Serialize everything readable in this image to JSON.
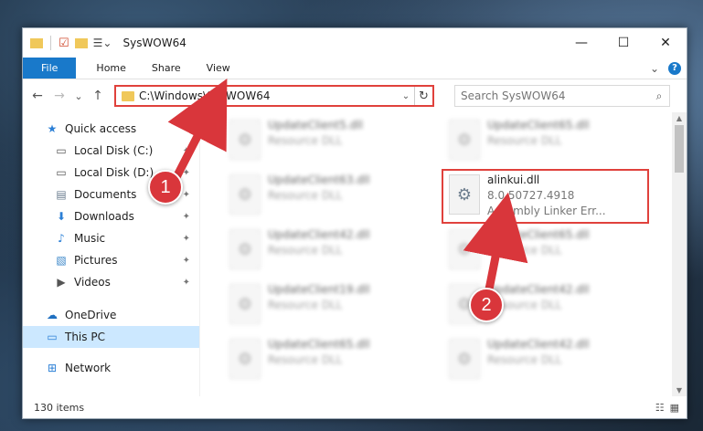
{
  "window": {
    "title": "SysWOW64",
    "controls": {
      "minimize": "—",
      "maximize": "☐",
      "close": "✕"
    }
  },
  "ribbon": {
    "tabs": [
      "File",
      "Home",
      "Share",
      "View"
    ],
    "expand": "⌄",
    "help": "?"
  },
  "navbar": {
    "back": "←",
    "forward": "→",
    "recent": "⌄",
    "up": "↑",
    "address": "C:\\Windows\\SysWOW64",
    "address_chevron": "⌄",
    "refresh": "↻",
    "search_placeholder": "Search SysWOW64"
  },
  "sidebar": {
    "items": [
      {
        "label": "Quick access",
        "icon": "★",
        "color": "#2b7fd6"
      },
      {
        "label": "Local Disk (C:)",
        "icon": "▭",
        "pinned": true
      },
      {
        "label": "Local Disk (D:)",
        "icon": "▭",
        "pinned": true
      },
      {
        "label": "Documents",
        "icon": "▤",
        "pinned": true
      },
      {
        "label": "Downloads",
        "icon": "⬇",
        "pinned": true
      },
      {
        "label": "Music",
        "icon": "♪",
        "pinned": true
      },
      {
        "label": "Pictures",
        "icon": "▧",
        "pinned": true
      },
      {
        "label": "Videos",
        "icon": "▶",
        "pinned": true
      },
      {
        "label": "OneDrive",
        "icon": "☁"
      },
      {
        "label": "This PC",
        "icon": "▭"
      },
      {
        "label": "Network",
        "icon": "⊞"
      }
    ],
    "pin_glyph": "✦"
  },
  "files": {
    "left_column": [
      {
        "name": "UpdateClient5.dll",
        "type": "Resource DLL"
      },
      {
        "name": "UpdateClient63.dll",
        "type": "Resource DLL"
      },
      {
        "name": "UpdateClient42.dll",
        "type": "Resource DLL"
      },
      {
        "name": "UpdateClient19.dll",
        "type": "Resource DLL"
      },
      {
        "name": "UpdateClient65.dll",
        "type": "Resource DLL"
      }
    ],
    "right_column": [
      {
        "name": "UpdateClient65.dll",
        "type": "Resource DLL"
      },
      {
        "name": "alinkui.dll",
        "version": "8.0.50727.4918",
        "type": "Assembly Linker Err..."
      },
      {
        "name": "UpdateClient65.dll",
        "type": "Resource DLL"
      },
      {
        "name": "UpdateClient42.dll",
        "type": "Resource DLL"
      },
      {
        "name": "UpdateClient42.dll",
        "type": "Resource DLL"
      }
    ]
  },
  "status": {
    "count": "130 items",
    "view_details": "☷",
    "view_tiles": "▦"
  },
  "annotations": {
    "badge1": "1",
    "badge2": "2",
    "color": "#d9363b"
  },
  "colors": {
    "accent": "#1979ca",
    "highlight": "#e0413c",
    "selected": "#cce8ff"
  }
}
